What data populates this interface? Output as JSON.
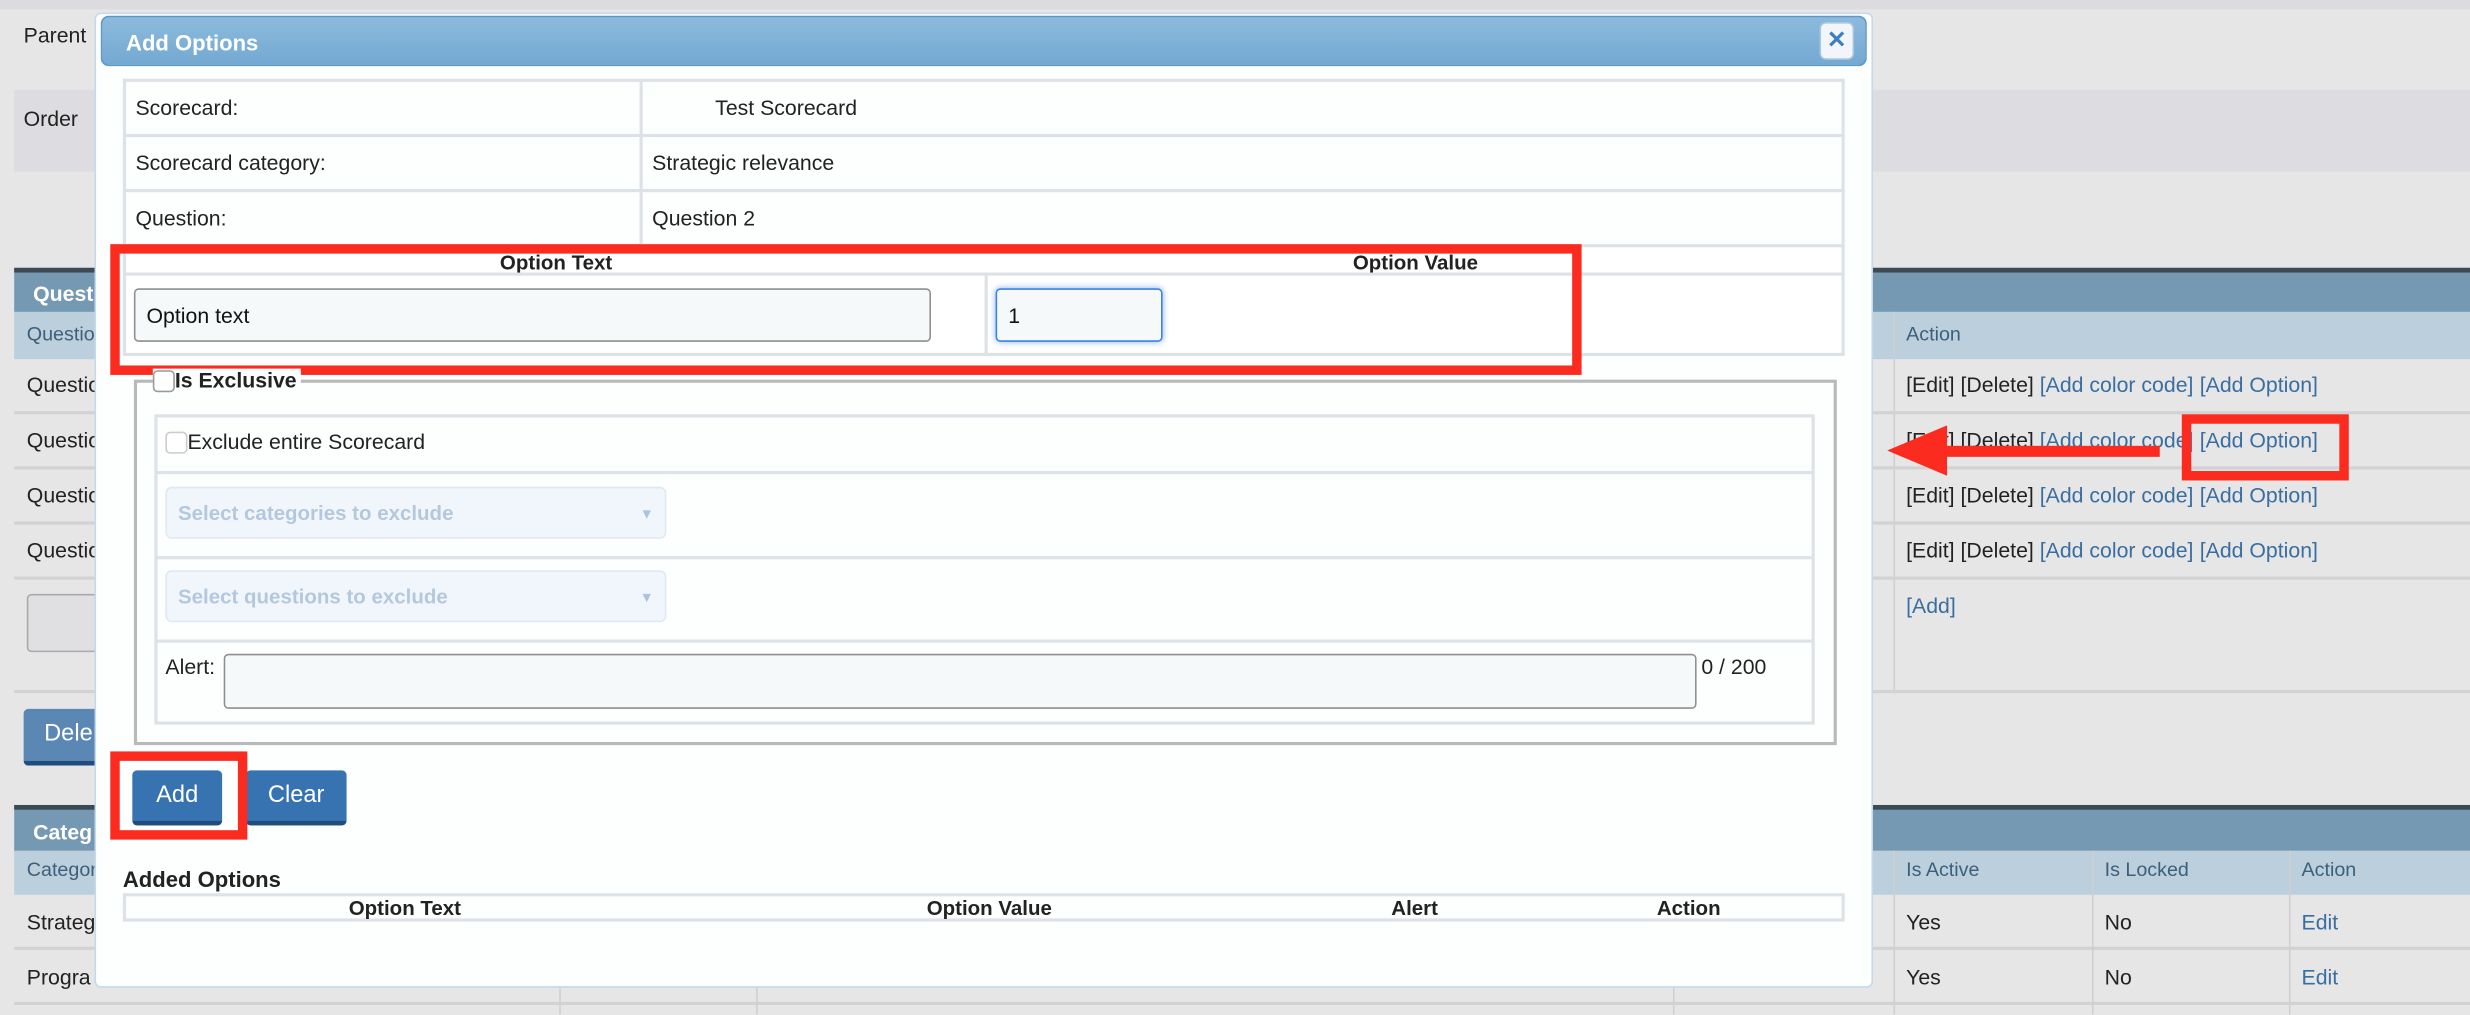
{
  "background": {
    "parent_label": "Parent",
    "order_label": "Order",
    "questions_table": {
      "title": "Quest",
      "col_first": "Questio",
      "col_action": "Action",
      "rows": [
        {
          "name": "Questio",
          "actions": {
            "edit": "[Edit]",
            "delete": "[Delete]",
            "color": "[Add color code]",
            "option": "[Add Option]"
          }
        },
        {
          "name": "Questio",
          "actions": {
            "edit": "[Edit]",
            "delete": "[Delete]",
            "color": "[Add color code]",
            "option": "[Add Option]"
          }
        },
        {
          "name": "Questio",
          "actions": {
            "edit": "[Edit]",
            "delete": "[Delete]",
            "color": "[Add color code]",
            "option": "[Add Option]"
          }
        },
        {
          "name": "Questio",
          "actions": {
            "edit": "[Edit]",
            "delete": "[Delete]",
            "color": "[Add color code]",
            "option": "[Add Option]"
          }
        }
      ],
      "add_link": "[Add]"
    },
    "delete_button": "Dele",
    "categories_table": {
      "title": "Categ",
      "col_first": "Categor",
      "col_active": "Is Active",
      "col_locked": "Is Locked",
      "col_action": "Action",
      "rows": [
        {
          "name": "Strateg",
          "active": "Yes",
          "locked": "No",
          "action": "Edit"
        },
        {
          "name": "Progra",
          "active": "Yes",
          "locked": "No",
          "action": "Edit"
        }
      ]
    }
  },
  "modal": {
    "title": "Add Options",
    "close_icon": "close-icon",
    "info": [
      {
        "label": "Scorecard:",
        "value": "Test Scorecard"
      },
      {
        "label": "Scorecard category:",
        "value": "Strategic relevance"
      },
      {
        "label": "Question:",
        "value": "Question 2"
      }
    ],
    "option_text_header": "Option Text",
    "option_value_header": "Option Value",
    "option_text_value": "Option text",
    "option_value_value": "1",
    "is_exclusive_label": "Is Exclusive",
    "exclude_scorecard_label": "Exclude entire Scorecard",
    "categories_placeholder": "Select categories to exclude",
    "questions_placeholder": "Select questions to exclude",
    "alert_label": "Alert:",
    "alert_counter": "0 / 200",
    "add_button": "Add",
    "clear_button": "Clear",
    "added_options_title": "Added Options",
    "added_columns": [
      "Option Text",
      "Option Value",
      "Alert",
      "Action"
    ]
  },
  "annotation_color": "#fb2b1f"
}
